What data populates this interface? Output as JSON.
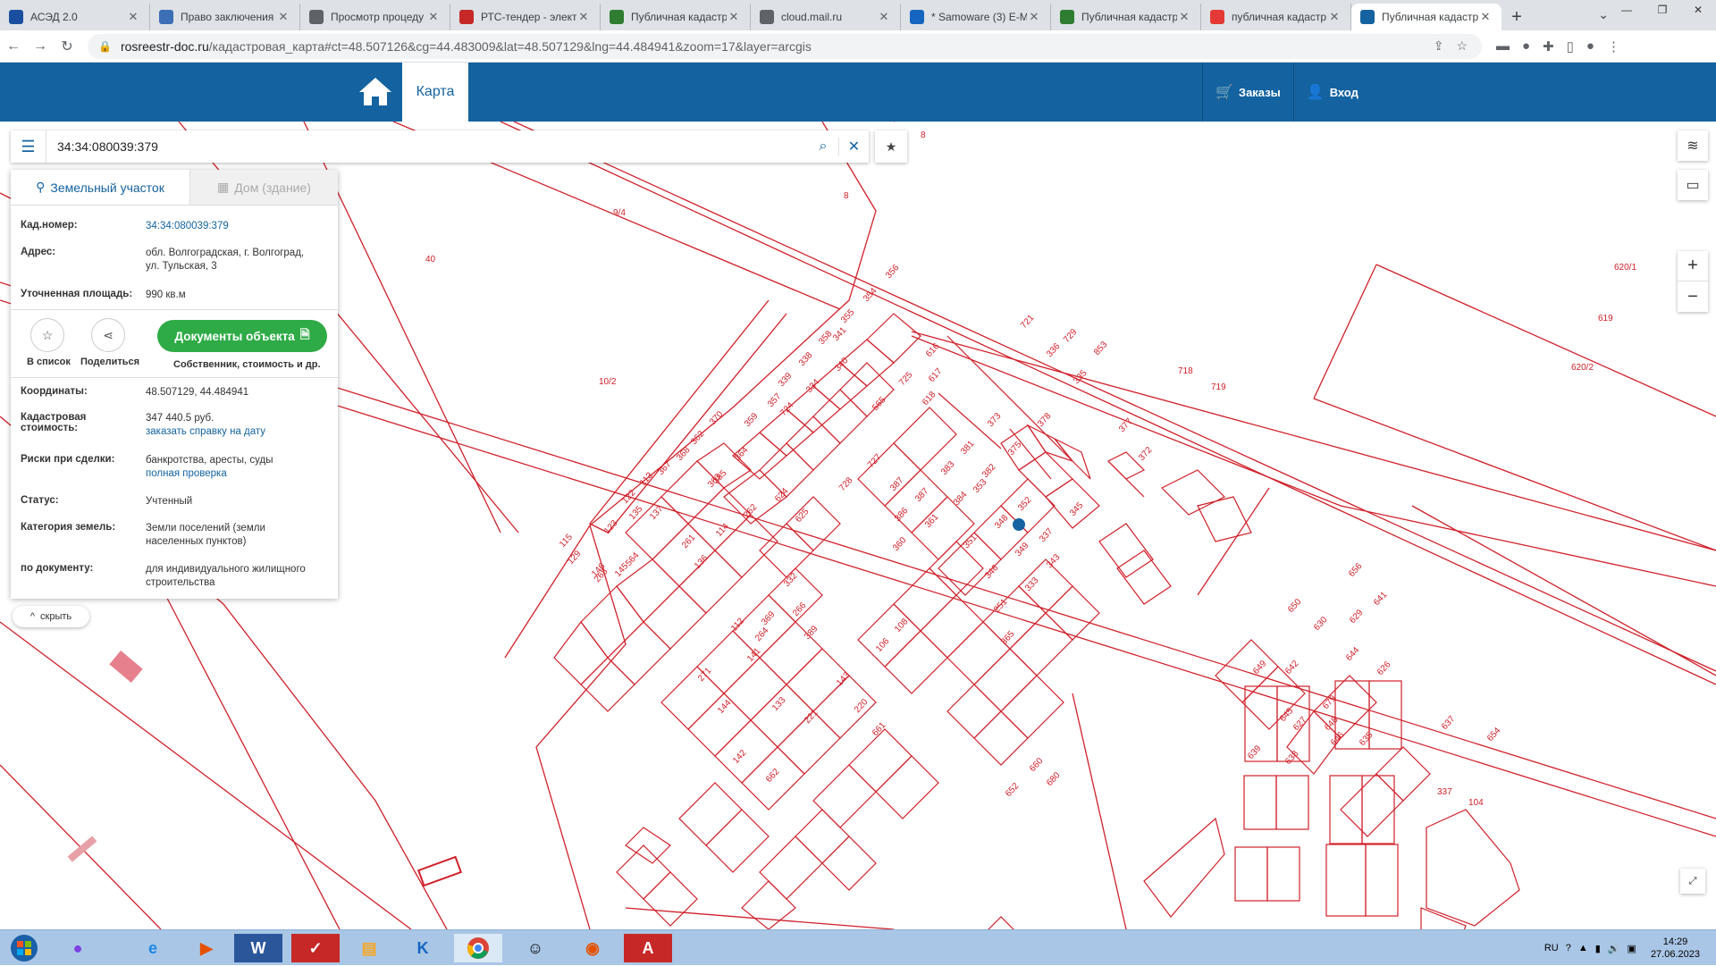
{
  "browser": {
    "tabs": [
      {
        "title": "АСЭД 2.0",
        "icon": "ased-favicon",
        "color": "#1a4fa0"
      },
      {
        "title": "Право заключения",
        "icon": "emblem-favicon",
        "color": "#3b6fb6"
      },
      {
        "title": "Просмотр процеду",
        "icon": "globe-favicon",
        "color": "#5f6368"
      },
      {
        "title": "РТС-тендер - элект",
        "icon": "rts-favicon",
        "color": "#c62828"
      },
      {
        "title": "Публичная кадастр",
        "icon": "leaf-favicon",
        "color": "#2e7d32"
      },
      {
        "title": "cloud.mail.ru",
        "icon": "globe-favicon",
        "color": "#5f6368"
      },
      {
        "title": "* Samoware (3) E-M",
        "icon": "samoware-favicon",
        "color": "#1565c0"
      },
      {
        "title": "Публичная кадастр",
        "icon": "check-favicon",
        "color": "#2e7d32"
      },
      {
        "title": "публичная кадастр",
        "icon": "yandex-favicon",
        "color": "#e53935"
      },
      {
        "title": "Публичная кадастр",
        "icon": "globe-favicon",
        "color": "#1463a0",
        "active": true
      }
    ],
    "url_host": "rosreestr-doc.ru",
    "url_path": "/кадастровая_карта#ct=48.507126&cg=44.483009&lat=48.507129&lng=44.484941&zoom=17&layer=arcgis"
  },
  "header": {
    "map_label": "Карта",
    "orders_label": "Заказы",
    "login_label": "Вход",
    "brand_color": "#1463a0"
  },
  "search": {
    "query": "34:34:080039:379"
  },
  "panel": {
    "tab_land": "Земельный участок",
    "tab_house": "Дом (здание)",
    "cadnum_label": "Кад.номер:",
    "cadnum_value": "34:34:080039:379",
    "address_label": "Адрес:",
    "address_value_1": "обл. Волгоградская, г. Волгоград,",
    "address_value_2": "ул. Тульская, 3",
    "area_label": "Уточненная площадь:",
    "area_value": "990 кв.м",
    "add_list_label": "В список",
    "share_label": "Поделиться",
    "docs_button": "Документы объекта",
    "docs_sub": "Собственник, стоимость и др.",
    "coords_label": "Координаты:",
    "coords_value": "48.507129, 44.484941",
    "cost_label_1": "Кадастровая",
    "cost_label_2": "стоимость:",
    "cost_value": "347 440.5 руб.",
    "cost_link": "заказать справку на дату",
    "risk_label": "Риски при сделки:",
    "risk_value": "банкротства, аресты, суды",
    "risk_link": "полная проверка",
    "status_label": "Статус:",
    "status_value": "Учтенный",
    "category_label": "Категория земель:",
    "category_value_1": "Земли поселений (земли",
    "category_value_2": "населенных пунктов)",
    "bydoc_label": "по документу:",
    "bydoc_value_1": "для индивидуального жилищного",
    "bydoc_value_2": "строительства",
    "hide_label": "скрыть"
  },
  "map": {
    "parcel_color": "#d0202a",
    "marker_color": "#1463a0",
    "labels": [
      "8",
      "8",
      "8",
      "9/4",
      "40",
      "10/2",
      "356",
      "354",
      "355",
      "358",
      "338",
      "339",
      "357",
      "359",
      "341",
      "340",
      "334",
      "724",
      "616",
      "725",
      "565",
      "617",
      "618",
      "721",
      "729",
      "336",
      "853",
      "335",
      "718",
      "719",
      "620/1",
      "619",
      "620/2",
      "373",
      "378",
      "375",
      "381",
      "382",
      "383",
      "387",
      "386",
      "360",
      "361",
      "384",
      "387",
      "377",
      "372",
      "727",
      "728",
      "370",
      "362",
      "368",
      "367",
      "364",
      "363",
      "113",
      "122",
      "137",
      "135",
      "123",
      "115",
      "145",
      "146",
      "129",
      "268",
      "564",
      "385",
      "624",
      "262",
      "625",
      "114",
      "261",
      "136",
      "353",
      "352",
      "348",
      "345",
      "337",
      "351",
      "349",
      "346",
      "343",
      "333",
      "251",
      "365",
      "332",
      "266",
      "369",
      "389",
      "108",
      "106",
      "112",
      "264",
      "141",
      "271",
      "144",
      "220",
      "143",
      "133",
      "221",
      "142",
      "661",
      "662",
      "660",
      "680",
      "652",
      "656",
      "641",
      "629",
      "650",
      "630",
      "644",
      "626",
      "679",
      "627",
      "648",
      "649",
      "642",
      "639",
      "638",
      "645",
      "646",
      "635",
      "637",
      "654",
      "337",
      "104"
    ]
  },
  "taskbar": {
    "lang": "RU",
    "time": "14:29",
    "date": "27.06.2023"
  }
}
